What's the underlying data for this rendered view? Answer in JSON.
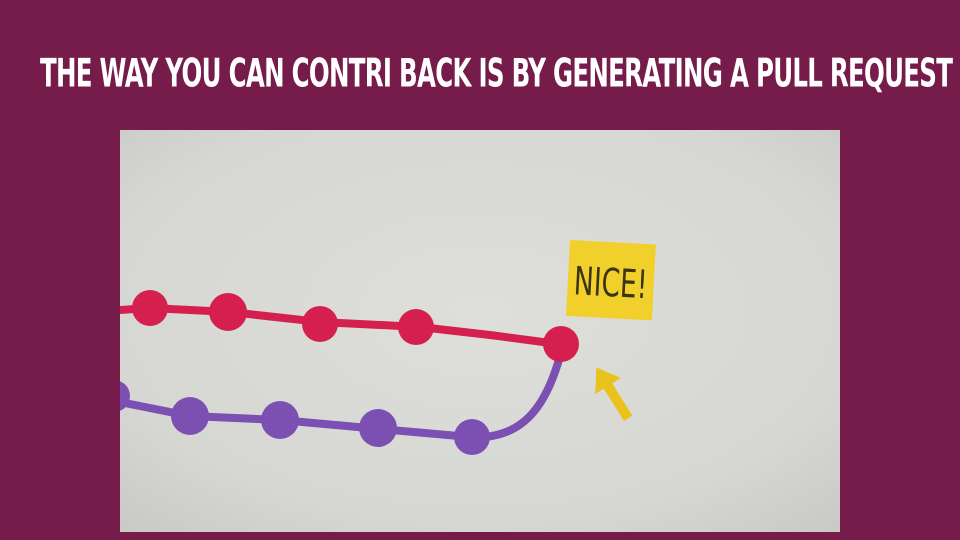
{
  "slide": {
    "title": "The way you can contri back is by generating a pull request"
  },
  "photo": {
    "sticky_note_text": "NICE!",
    "colors": {
      "background": "#761c4a",
      "paper": "#d8d9d5",
      "pink_branch": "#d5204f",
      "purple_branch": "#7c4fb3",
      "sticky_note": "#f2d02c",
      "arrow": "#e9c21c",
      "title_text": "#ffffff"
    }
  }
}
